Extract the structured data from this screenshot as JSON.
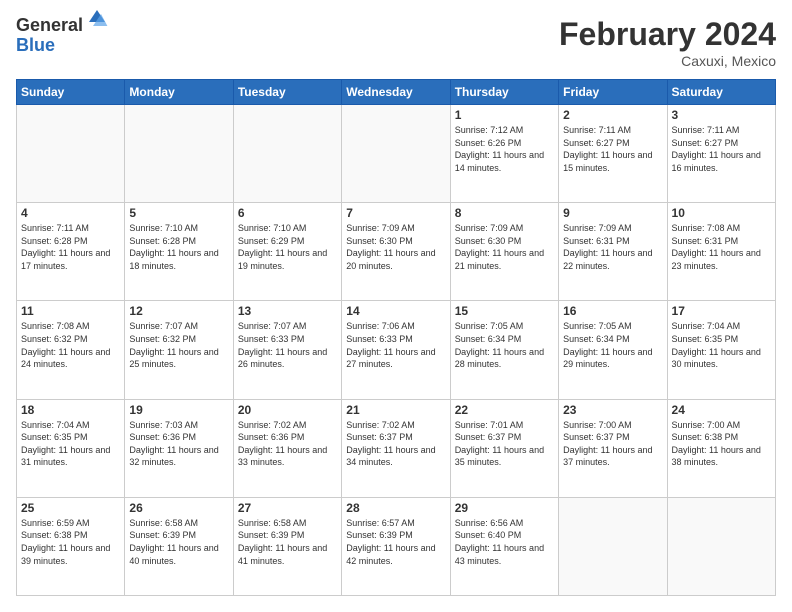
{
  "logo": {
    "general": "General",
    "blue": "Blue"
  },
  "header": {
    "month_year": "February 2024",
    "location": "Caxuxi, Mexico"
  },
  "weekdays": [
    "Sunday",
    "Monday",
    "Tuesday",
    "Wednesday",
    "Thursday",
    "Friday",
    "Saturday"
  ],
  "weeks": [
    [
      {
        "day": "",
        "info": ""
      },
      {
        "day": "",
        "info": ""
      },
      {
        "day": "",
        "info": ""
      },
      {
        "day": "",
        "info": ""
      },
      {
        "day": "1",
        "info": "Sunrise: 7:12 AM\nSunset: 6:26 PM\nDaylight: 11 hours and 14 minutes."
      },
      {
        "day": "2",
        "info": "Sunrise: 7:11 AM\nSunset: 6:27 PM\nDaylight: 11 hours and 15 minutes."
      },
      {
        "day": "3",
        "info": "Sunrise: 7:11 AM\nSunset: 6:27 PM\nDaylight: 11 hours and 16 minutes."
      }
    ],
    [
      {
        "day": "4",
        "info": "Sunrise: 7:11 AM\nSunset: 6:28 PM\nDaylight: 11 hours and 17 minutes."
      },
      {
        "day": "5",
        "info": "Sunrise: 7:10 AM\nSunset: 6:28 PM\nDaylight: 11 hours and 18 minutes."
      },
      {
        "day": "6",
        "info": "Sunrise: 7:10 AM\nSunset: 6:29 PM\nDaylight: 11 hours and 19 minutes."
      },
      {
        "day": "7",
        "info": "Sunrise: 7:09 AM\nSunset: 6:30 PM\nDaylight: 11 hours and 20 minutes."
      },
      {
        "day": "8",
        "info": "Sunrise: 7:09 AM\nSunset: 6:30 PM\nDaylight: 11 hours and 21 minutes."
      },
      {
        "day": "9",
        "info": "Sunrise: 7:09 AM\nSunset: 6:31 PM\nDaylight: 11 hours and 22 minutes."
      },
      {
        "day": "10",
        "info": "Sunrise: 7:08 AM\nSunset: 6:31 PM\nDaylight: 11 hours and 23 minutes."
      }
    ],
    [
      {
        "day": "11",
        "info": "Sunrise: 7:08 AM\nSunset: 6:32 PM\nDaylight: 11 hours and 24 minutes."
      },
      {
        "day": "12",
        "info": "Sunrise: 7:07 AM\nSunset: 6:32 PM\nDaylight: 11 hours and 25 minutes."
      },
      {
        "day": "13",
        "info": "Sunrise: 7:07 AM\nSunset: 6:33 PM\nDaylight: 11 hours and 26 minutes."
      },
      {
        "day": "14",
        "info": "Sunrise: 7:06 AM\nSunset: 6:33 PM\nDaylight: 11 hours and 27 minutes."
      },
      {
        "day": "15",
        "info": "Sunrise: 7:05 AM\nSunset: 6:34 PM\nDaylight: 11 hours and 28 minutes."
      },
      {
        "day": "16",
        "info": "Sunrise: 7:05 AM\nSunset: 6:34 PM\nDaylight: 11 hours and 29 minutes."
      },
      {
        "day": "17",
        "info": "Sunrise: 7:04 AM\nSunset: 6:35 PM\nDaylight: 11 hours and 30 minutes."
      }
    ],
    [
      {
        "day": "18",
        "info": "Sunrise: 7:04 AM\nSunset: 6:35 PM\nDaylight: 11 hours and 31 minutes."
      },
      {
        "day": "19",
        "info": "Sunrise: 7:03 AM\nSunset: 6:36 PM\nDaylight: 11 hours and 32 minutes."
      },
      {
        "day": "20",
        "info": "Sunrise: 7:02 AM\nSunset: 6:36 PM\nDaylight: 11 hours and 33 minutes."
      },
      {
        "day": "21",
        "info": "Sunrise: 7:02 AM\nSunset: 6:37 PM\nDaylight: 11 hours and 34 minutes."
      },
      {
        "day": "22",
        "info": "Sunrise: 7:01 AM\nSunset: 6:37 PM\nDaylight: 11 hours and 35 minutes."
      },
      {
        "day": "23",
        "info": "Sunrise: 7:00 AM\nSunset: 6:37 PM\nDaylight: 11 hours and 37 minutes."
      },
      {
        "day": "24",
        "info": "Sunrise: 7:00 AM\nSunset: 6:38 PM\nDaylight: 11 hours and 38 minutes."
      }
    ],
    [
      {
        "day": "25",
        "info": "Sunrise: 6:59 AM\nSunset: 6:38 PM\nDaylight: 11 hours and 39 minutes."
      },
      {
        "day": "26",
        "info": "Sunrise: 6:58 AM\nSunset: 6:39 PM\nDaylight: 11 hours and 40 minutes."
      },
      {
        "day": "27",
        "info": "Sunrise: 6:58 AM\nSunset: 6:39 PM\nDaylight: 11 hours and 41 minutes."
      },
      {
        "day": "28",
        "info": "Sunrise: 6:57 AM\nSunset: 6:39 PM\nDaylight: 11 hours and 42 minutes."
      },
      {
        "day": "29",
        "info": "Sunrise: 6:56 AM\nSunset: 6:40 PM\nDaylight: 11 hours and 43 minutes."
      },
      {
        "day": "",
        "info": ""
      },
      {
        "day": "",
        "info": ""
      }
    ]
  ]
}
